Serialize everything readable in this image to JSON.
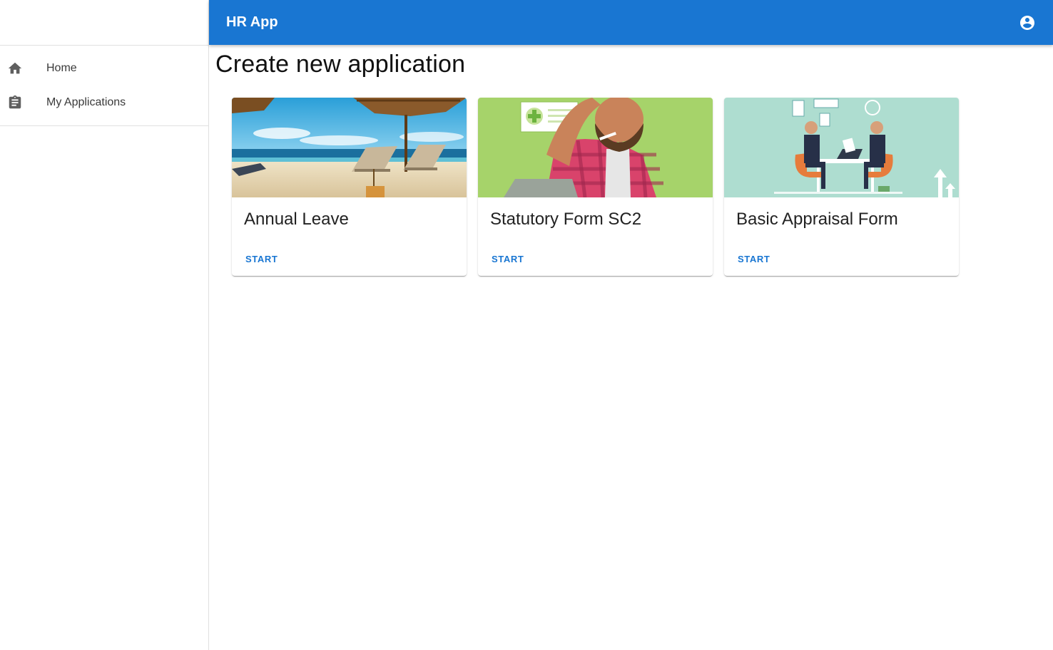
{
  "app": {
    "title": "HR App"
  },
  "sidebar": {
    "items": [
      {
        "label": "Home",
        "icon": "home-icon"
      },
      {
        "label": "My Applications",
        "icon": "clipboard-icon"
      }
    ]
  },
  "header": {
    "account_icon": "account-circle-icon"
  },
  "main": {
    "title": "Create new application",
    "cards": [
      {
        "title": "Annual Leave",
        "action": "START",
        "image": "beach-illustration"
      },
      {
        "title": "Statutory Form SC2",
        "action": "START",
        "image": "sick-man-illustration"
      },
      {
        "title": "Basic Appraisal Form",
        "action": "START",
        "image": "business-meeting-illustration"
      }
    ]
  },
  "colors": {
    "primary": "#1976d2",
    "text": "#222222",
    "icon": "#5f5f5f"
  }
}
